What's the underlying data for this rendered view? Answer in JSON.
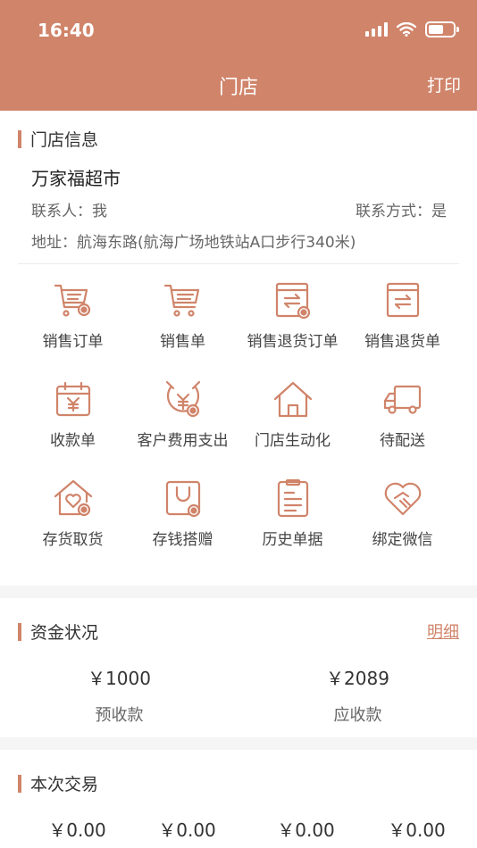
{
  "status_bar": {
    "time": "16:40"
  },
  "nav": {
    "title": "门店",
    "action": "打印"
  },
  "store_info": {
    "section_title": "门店信息",
    "name": "万家福超市",
    "contact": "联系人：我",
    "contact_way": "联系方式：是",
    "address": "地址：航海东路(航海广场地铁站A口步行340米)"
  },
  "menu": [
    {
      "label": "销售订单",
      "icon": "cart-order-icon"
    },
    {
      "label": "销售单",
      "icon": "cart-icon"
    },
    {
      "label": "销售退货订单",
      "icon": "return-order-icon"
    },
    {
      "label": "销售退货单",
      "icon": "return-icon"
    },
    {
      "label": "收款单",
      "icon": "calendar-yuan-icon"
    },
    {
      "label": "客户费用支出",
      "icon": "expense-icon"
    },
    {
      "label": "门店生动化",
      "icon": "house-icon"
    },
    {
      "label": "待配送",
      "icon": "truck-icon"
    },
    {
      "label": "存货取货",
      "icon": "house-heart-icon"
    },
    {
      "label": "存钱搭赠",
      "icon": "bag-icon"
    },
    {
      "label": "历史单据",
      "icon": "document-icon"
    },
    {
      "label": "绑定微信",
      "icon": "heart-hand-icon"
    }
  ],
  "funds": {
    "section_title": "资金状况",
    "detail_link": "明细",
    "prepaid": {
      "value": "￥1000",
      "label": "预收款"
    },
    "receivable": {
      "value": "￥2089",
      "label": "应收款"
    }
  },
  "trade": {
    "section_title": "本次交易",
    "values": [
      "￥0.00",
      "￥0.00",
      "￥0.00",
      "￥0.00"
    ]
  },
  "colors": {
    "accent": "#d0846a",
    "background": "#f5f5f5"
  }
}
